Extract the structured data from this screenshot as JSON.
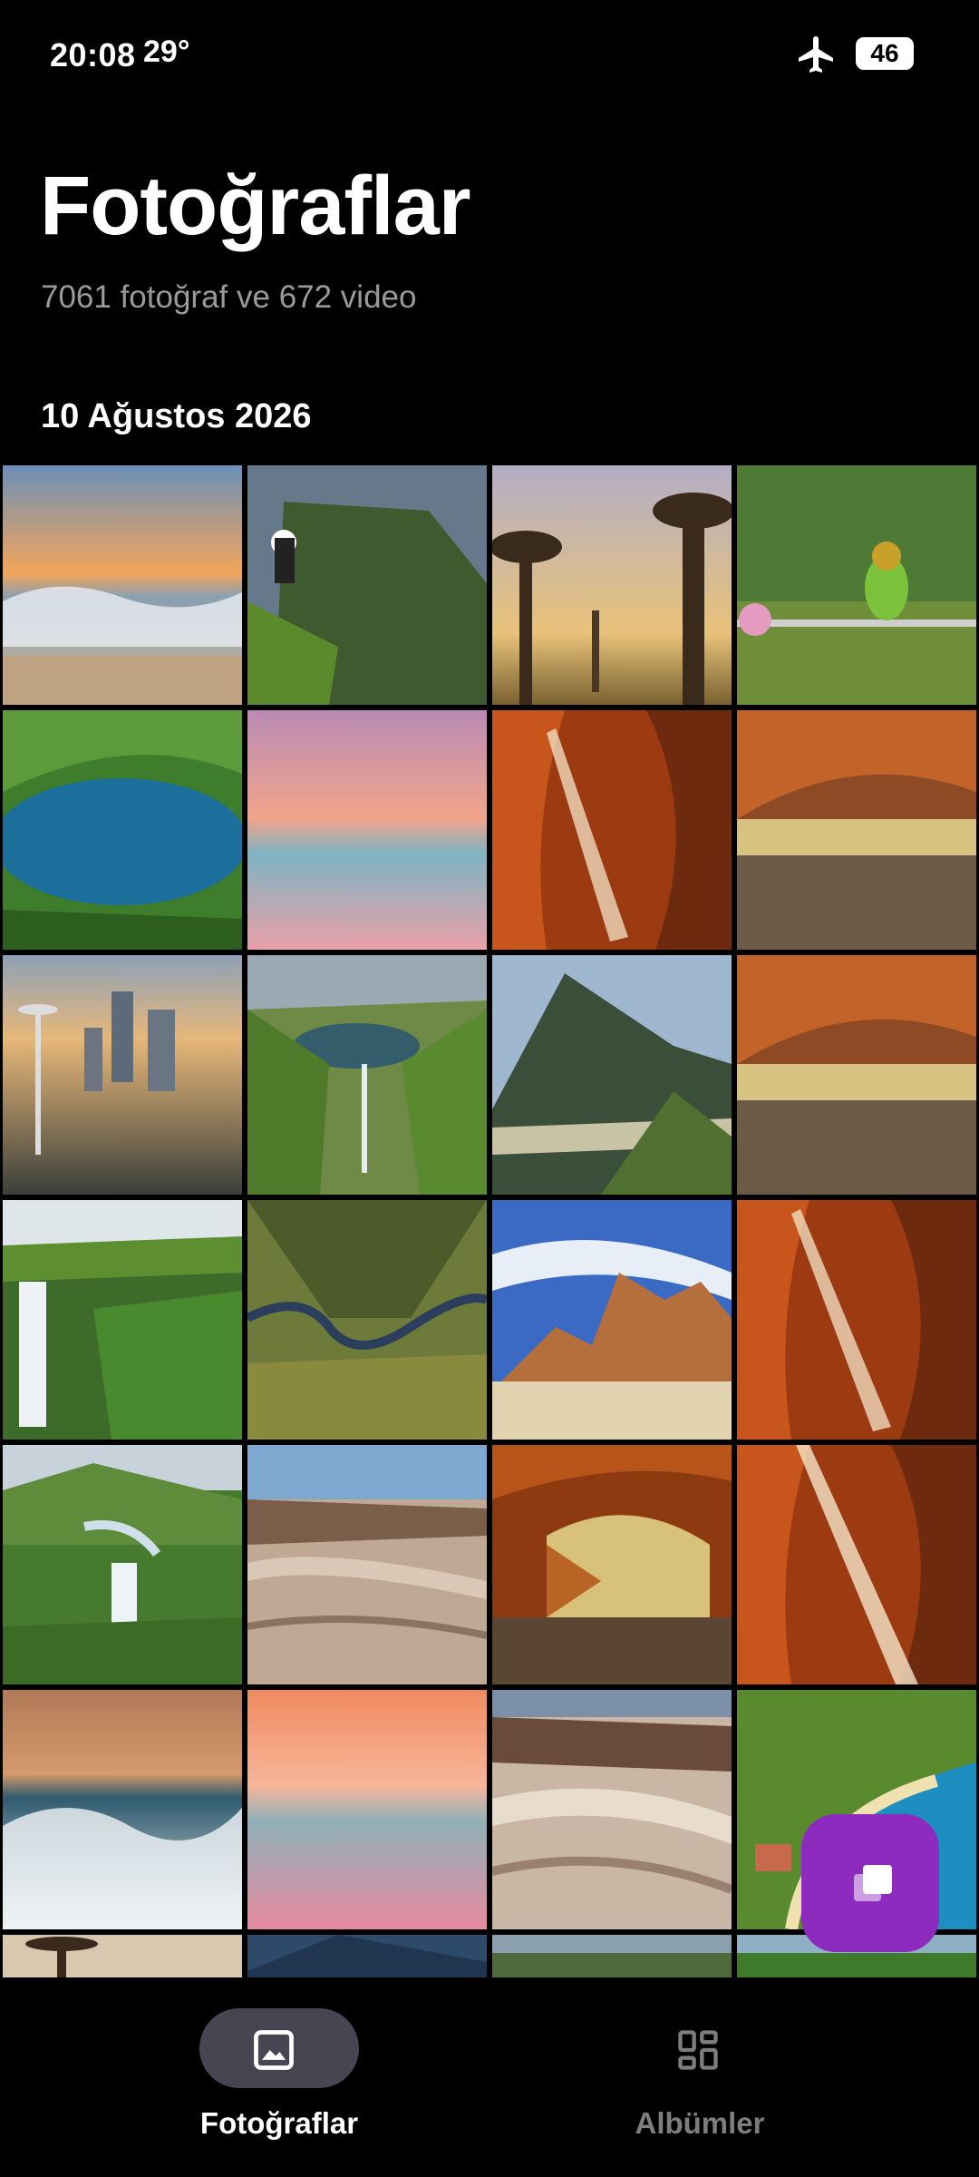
{
  "status_bar": {
    "time": "20:08",
    "temperature": "29°",
    "battery": "46",
    "icons": [
      "airplane-icon"
    ]
  },
  "header": {
    "title": "Fotoğraflar",
    "subtitle": "7061 fotoğraf ve 672 video"
  },
  "section": {
    "date": "10 Ağustos 2026"
  },
  "photos": [
    "ocean-sunset",
    "puffin-cliffs",
    "baobab-trees",
    "bee-eater-bird",
    "green-lagoon",
    "pink-sea-sunset",
    "antelope-canyon",
    "mesa-arch",
    "seattle-skyline",
    "fjord-waterfall",
    "green-mountain-lake",
    "mesa-arch",
    "waterfall-cliff",
    "aerial-river-valley",
    "desert-rocks",
    "antelope-canyon",
    "valley-waterfall",
    "badlands",
    "canyon-arch",
    "antelope-canyon",
    "crashing-waves",
    "pink-sea-sunset",
    "badlands",
    "beach-resort",
    "baobab-trees",
    "blue-mountain",
    "green-valley",
    "green-coast"
  ],
  "fab": {
    "icon": "stacked-squares-icon"
  },
  "bottom_nav": {
    "items": [
      {
        "label": "Fotoğraflar",
        "icon": "image-icon",
        "active": true
      },
      {
        "label": "Albümler",
        "icon": "albums-grid-icon",
        "active": false
      }
    ]
  },
  "colors": {
    "background": "#000000",
    "accent": "#8d2bbf",
    "nav_pill": "#484452",
    "muted_text": "#9a9a9a"
  }
}
